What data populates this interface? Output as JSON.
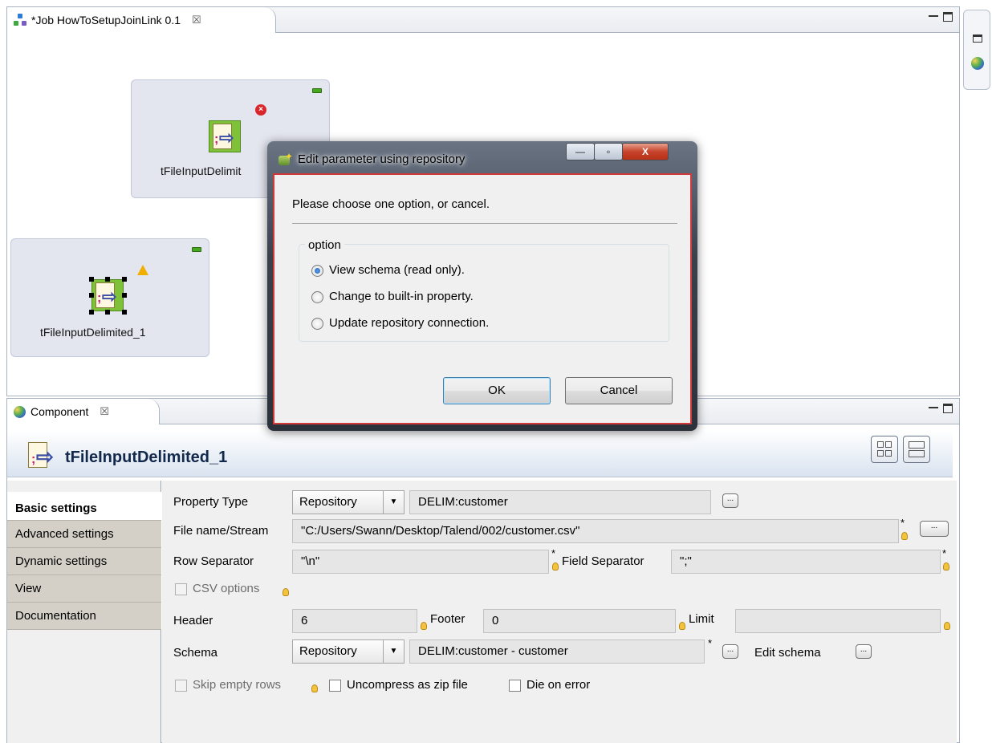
{
  "editor": {
    "tab_label": "*Job HowToSetupJoinLink 0.1",
    "close_glyph": "☒",
    "min_glyph": "—",
    "max_glyph": "□",
    "nodes": [
      {
        "label": "tFileInputDelimit",
        "status": "error-icon"
      },
      {
        "label": "tFileInputDelimited_1",
        "status": "warning-icon"
      }
    ]
  },
  "component": {
    "tab_label": "Component",
    "close_glyph": "☒",
    "title": "tFileInputDelimited_1",
    "vtabs": [
      "Basic settings",
      "Advanced settings",
      "Dynamic settings",
      "View",
      "Documentation"
    ],
    "active_vtab": "Basic settings",
    "form": {
      "property_type_label": "Property Type",
      "property_type_value": "Repository",
      "property_repo": "DELIM:customer",
      "file_label": "File name/Stream",
      "file_value": "\"C:/Users/Swann/Desktop/Talend/002/customer.csv\"",
      "row_sep_label": "Row Separator",
      "row_sep_value": "\"\\n\"",
      "field_sep_label": "Field Separator",
      "field_sep_value": "\";\"",
      "csv_label": "CSV options",
      "header_label": "Header",
      "header_value": "6",
      "footer_label": "Footer",
      "footer_value": "0",
      "limit_label": "Limit",
      "limit_value": "",
      "schema_label": "Schema",
      "schema_value": "Repository",
      "schema_repo": "DELIM:customer - customer",
      "edit_schema_label": "Edit schema",
      "skip_label": "Skip empty rows",
      "uncompress_label": "Uncompress as zip file",
      "die_label": "Die on error",
      "ellipsis": "...",
      "dropdown_glyph": "▼",
      "required_star": "*"
    }
  },
  "dialog": {
    "title": "Edit parameter using repository",
    "message": "Please choose one option, or cancel.",
    "group_label": "option",
    "options": [
      "View schema (read only).",
      "Change to built-in property.",
      "Update repository connection."
    ],
    "selected_option": 0,
    "ok_label": "OK",
    "cancel_label": "Cancel",
    "win_min": "—",
    "win_max": "▫",
    "win_close": "X"
  }
}
